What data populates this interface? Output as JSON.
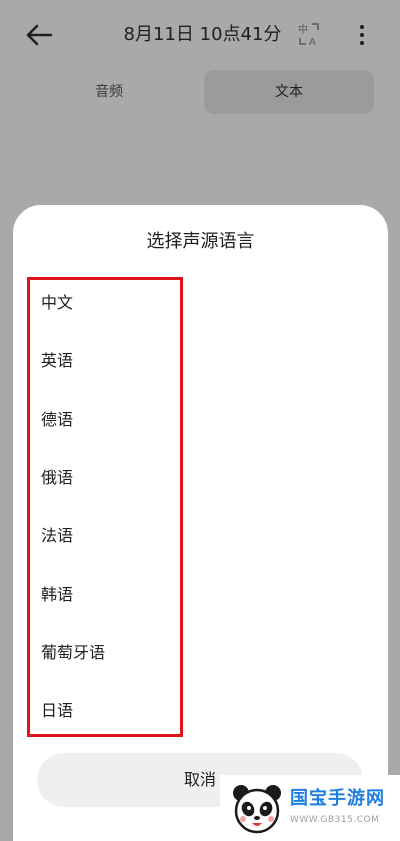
{
  "header": {
    "title": "8月11日 10点41分",
    "translate_glyph_top": "中",
    "translate_glyph_bottom": "A"
  },
  "tabs": [
    {
      "label": "音频",
      "active": false
    },
    {
      "label": "文本",
      "active": true
    }
  ],
  "sheet": {
    "title": "选择声源语言",
    "languages": [
      "中文",
      "英语",
      "德语",
      "俄语",
      "法语",
      "韩语",
      "葡萄牙语",
      "日语"
    ],
    "cancel_label": "取消"
  },
  "watermark": {
    "site_name": "国宝手游网",
    "url": "WWW.GB315.COM"
  },
  "colors": {
    "overlay": "#a9a9a9",
    "highlight_border": "#e0141b",
    "sheet_bg": "#ffffff",
    "cancel_bg": "#efefef",
    "watermark_blue": "#1f7fe0"
  }
}
